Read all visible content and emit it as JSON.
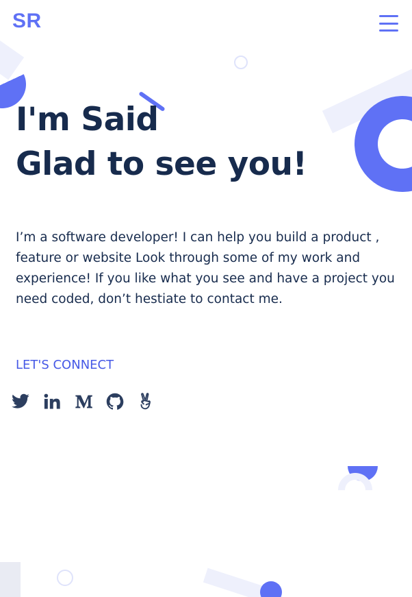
{
  "header": {
    "logo": "SR",
    "menu_icon": "hamburger-menu-icon"
  },
  "hero": {
    "title_line1": "I'm Said",
    "title_line2": "Glad to see you!",
    "intro": "I’m a software developer! I can help you build a product , feature or website Look through some of my work and experience! If you like what you see and have a project you need coded, don’t hestiate to contact me."
  },
  "connect": {
    "label": "LET'S CONNECT"
  },
  "social": [
    {
      "name": "twitter-icon"
    },
    {
      "name": "linkedin-icon"
    },
    {
      "name": "medium-icon"
    },
    {
      "name": "github-icon"
    },
    {
      "name": "angellist-icon"
    }
  ],
  "colors": {
    "accent": "#5f71f5",
    "link": "#4659e6",
    "text": "#172b4d",
    "icon": "#2c3e5f",
    "decoration_light": "#eef0fc"
  }
}
